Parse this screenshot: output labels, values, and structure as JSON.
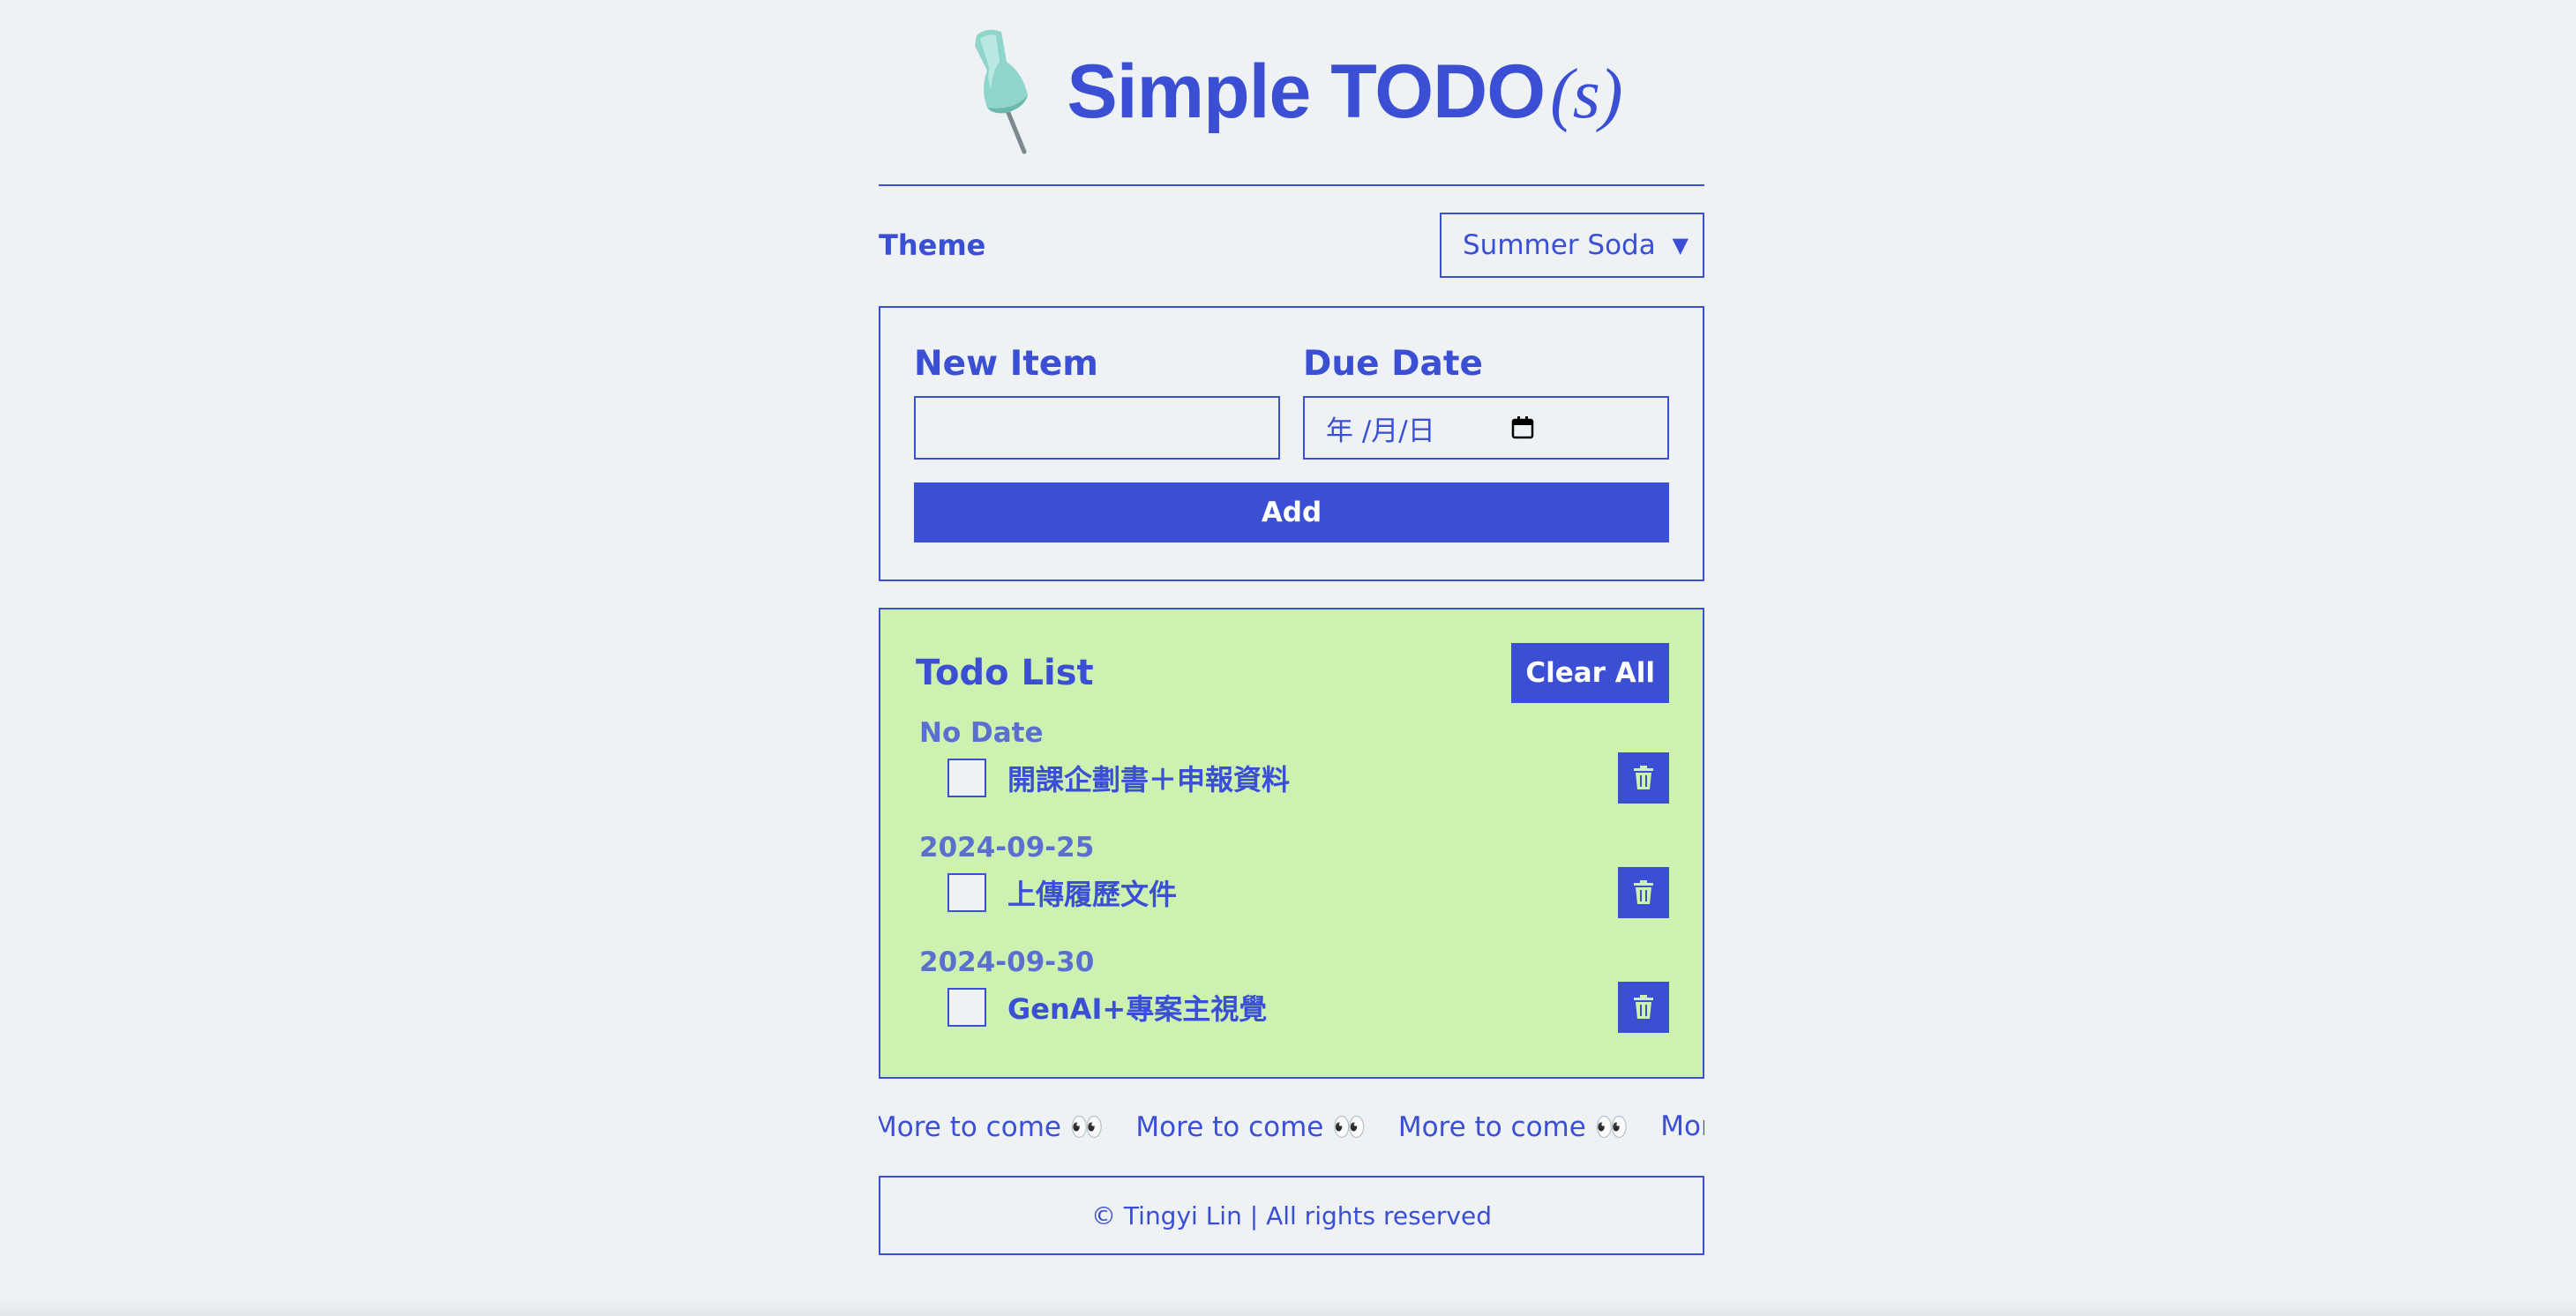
{
  "header": {
    "title_main": "Simple TODO",
    "title_suffix": "(s)",
    "icon": "pushpin-icon"
  },
  "theme": {
    "label": "Theme",
    "selected": "Summer Soda"
  },
  "form": {
    "new_item_label": "New Item",
    "new_item_value": "",
    "due_date_label": "Due Date",
    "due_date_placeholder": "年 /月/日",
    "add_label": "Add"
  },
  "todo": {
    "title": "Todo List",
    "clear_label": "Clear All",
    "groups": [
      {
        "date": "No Date",
        "items": [
          {
            "text": "開課企劃書＋申報資料",
            "checked": false
          }
        ]
      },
      {
        "date": "2024-09-25",
        "items": [
          {
            "text": "上傳履歷文件",
            "checked": false
          }
        ]
      },
      {
        "date": "2024-09-30",
        "items": [
          {
            "text": "GenAI+專案主視覺",
            "checked": false
          }
        ]
      }
    ]
  },
  "marquee": {
    "items": [
      "More to come 👀",
      "More to come 👀",
      "More to come 👀",
      "More to"
    ]
  },
  "footer": {
    "text": "© Tingyi Lin | All rights reserved"
  },
  "colors": {
    "accent": "#3a4fd4",
    "background": "#eef2f4",
    "todo_background": "#ccf1b1"
  }
}
